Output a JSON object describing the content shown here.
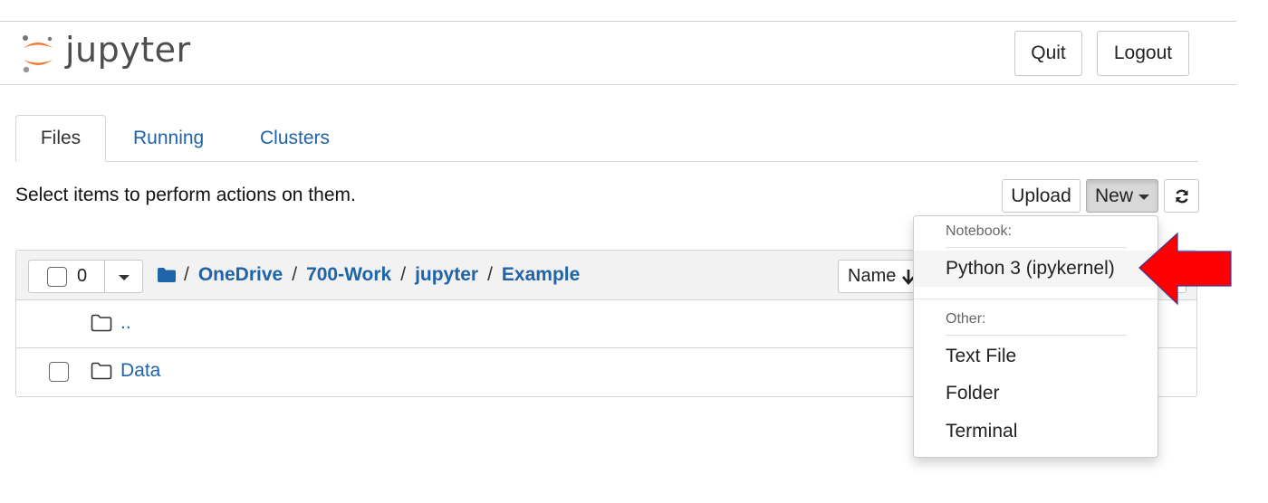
{
  "app": {
    "logo_text": "jupyter"
  },
  "header": {
    "quit_label": "Quit",
    "logout_label": "Logout"
  },
  "tabs": [
    {
      "label": "Files",
      "active": true
    },
    {
      "label": "Running",
      "active": false
    },
    {
      "label": "Clusters",
      "active": false
    }
  ],
  "toolbar": {
    "hint": "Select items to perform actions on them.",
    "upload_label": "Upload",
    "new_label": "New",
    "refresh_icon": "refresh-icon"
  },
  "list": {
    "selected_count": "0",
    "breadcrumb": [
      "OneDrive",
      "700-Work",
      "jupyter",
      "Example"
    ],
    "sort_label": "Name",
    "rows": [
      {
        "name": "..",
        "type": "parent"
      },
      {
        "name": "Data",
        "type": "folder"
      }
    ]
  },
  "new_menu": {
    "notebook_section": "Notebook:",
    "notebook_items": [
      "Python 3 (ipykernel)"
    ],
    "other_section": "Other:",
    "other_items": [
      "Text File",
      "Folder",
      "Terminal"
    ]
  },
  "colors": {
    "link": "#1f63a8",
    "logo_orange": "#f37726",
    "annotation_arrow": "#ff0000"
  }
}
